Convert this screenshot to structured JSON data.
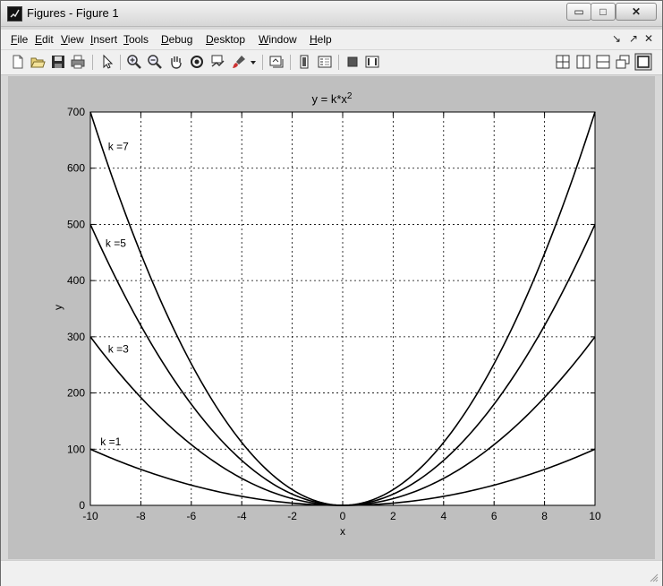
{
  "window": {
    "title": "Figures - Figure 1",
    "controls": {
      "minimize": "▭",
      "maximize": "□",
      "close": "✕"
    }
  },
  "menubar": {
    "items": [
      {
        "label": "File"
      },
      {
        "label": "Edit"
      },
      {
        "label": "View"
      },
      {
        "label": "Insert"
      },
      {
        "label": "Tools"
      },
      {
        "label": "Debug"
      },
      {
        "label": "Desktop"
      },
      {
        "label": "Window"
      },
      {
        "label": "Help"
      }
    ],
    "right_glyphs": [
      "↘",
      "↗",
      "✕"
    ]
  },
  "toolbar": {
    "icons": [
      "new-figure-icon",
      "open-file-icon",
      "save-icon",
      "print-icon",
      "edit-plot-arrow-icon",
      "zoom-in-icon",
      "zoom-out-icon",
      "pan-hand-icon",
      "rotate-3d-icon",
      "data-cursor-icon",
      "brush-icon",
      "brush-dropdown-icon",
      "link-plot-icon",
      "colorbar-icon",
      "legend-icon",
      "hide-plot-tools-icon",
      "show-plot-tools-icon"
    ],
    "dock_icons": [
      "tile-grid-icon",
      "tile-columns-icon",
      "tile-rows-icon",
      "float-icon",
      "maximize-figure-icon"
    ]
  },
  "chart_data": {
    "type": "line",
    "title": "y = k*x",
    "title_superscript": "2",
    "xlabel": "x",
    "ylabel": "y",
    "xlim": [
      -10,
      10
    ],
    "ylim": [
      0,
      700
    ],
    "xticks": [
      "-10",
      "-8",
      "-6",
      "-4",
      "-2",
      "0",
      "2",
      "4",
      "6",
      "8",
      "10"
    ],
    "yticks": [
      "0",
      "100",
      "200",
      "300",
      "400",
      "500",
      "600",
      "700"
    ],
    "grid": true,
    "line_color": "#000000",
    "series": [
      {
        "k": 1,
        "label": "k =1",
        "x": [
          -10,
          -9,
          -8,
          -7,
          -6,
          -5,
          -4,
          -3,
          -2,
          -1,
          0,
          1,
          2,
          3,
          4,
          5,
          6,
          7,
          8,
          9,
          10
        ],
        "y": [
          100,
          81,
          64,
          49,
          36,
          25,
          16,
          9,
          4,
          1,
          0,
          1,
          4,
          9,
          16,
          25,
          36,
          49,
          64,
          81,
          100
        ],
        "label_pos": [
          -9.6,
          107
        ]
      },
      {
        "k": 3,
        "label": "k =3",
        "x": [
          -10,
          -9,
          -8,
          -7,
          -6,
          -5,
          -4,
          -3,
          -2,
          -1,
          0,
          1,
          2,
          3,
          4,
          5,
          6,
          7,
          8,
          9,
          10
        ],
        "y": [
          300,
          243,
          192,
          147,
          108,
          75,
          48,
          27,
          12,
          3,
          0,
          3,
          12,
          27,
          48,
          75,
          108,
          147,
          192,
          243,
          300
        ],
        "label_pos": [
          -9.3,
          272
        ]
      },
      {
        "k": 5,
        "label": "k =5",
        "x": [
          -10,
          -9,
          -8,
          -7,
          -6,
          -5,
          -4,
          -3,
          -2,
          -1,
          0,
          1,
          2,
          3,
          4,
          5,
          6,
          7,
          8,
          9,
          10
        ],
        "y": [
          500,
          405,
          320,
          245,
          180,
          125,
          80,
          45,
          20,
          5,
          0,
          5,
          20,
          45,
          80,
          125,
          180,
          245,
          320,
          405,
          500
        ],
        "label_pos": [
          -9.4,
          460
        ]
      },
      {
        "k": 7,
        "label": "k =7",
        "x": [
          -10,
          -9,
          -8,
          -7,
          -6,
          -5,
          -4,
          -3,
          -2,
          -1,
          0,
          1,
          2,
          3,
          4,
          5,
          6,
          7,
          8,
          9,
          10
        ],
        "y": [
          700,
          567,
          448,
          343,
          252,
          175,
          112,
          63,
          28,
          7,
          0,
          7,
          28,
          63,
          112,
          175,
          252,
          343,
          448,
          567,
          700
        ],
        "label_pos": [
          -9.3,
          632
        ]
      }
    ]
  }
}
